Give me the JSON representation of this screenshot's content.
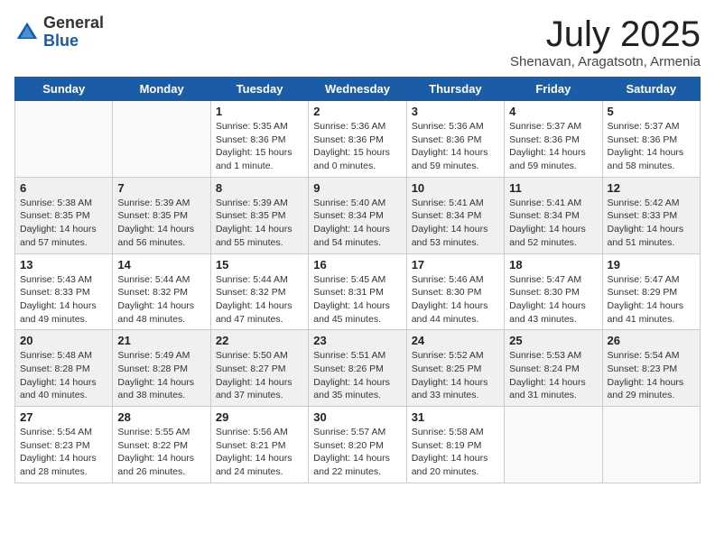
{
  "logo": {
    "general": "General",
    "blue": "Blue"
  },
  "title": "July 2025",
  "subtitle": "Shenavan, Aragatsotn, Armenia",
  "days_of_week": [
    "Sunday",
    "Monday",
    "Tuesday",
    "Wednesday",
    "Thursday",
    "Friday",
    "Saturday"
  ],
  "weeks": [
    [
      {
        "day": "",
        "sunrise": "",
        "sunset": "",
        "daylight": ""
      },
      {
        "day": "",
        "sunrise": "",
        "sunset": "",
        "daylight": ""
      },
      {
        "day": "1",
        "sunrise": "Sunrise: 5:35 AM",
        "sunset": "Sunset: 8:36 PM",
        "daylight": "Daylight: 15 hours and 1 minute."
      },
      {
        "day": "2",
        "sunrise": "Sunrise: 5:36 AM",
        "sunset": "Sunset: 8:36 PM",
        "daylight": "Daylight: 15 hours and 0 minutes."
      },
      {
        "day": "3",
        "sunrise": "Sunrise: 5:36 AM",
        "sunset": "Sunset: 8:36 PM",
        "daylight": "Daylight: 14 hours and 59 minutes."
      },
      {
        "day": "4",
        "sunrise": "Sunrise: 5:37 AM",
        "sunset": "Sunset: 8:36 PM",
        "daylight": "Daylight: 14 hours and 59 minutes."
      },
      {
        "day": "5",
        "sunrise": "Sunrise: 5:37 AM",
        "sunset": "Sunset: 8:36 PM",
        "daylight": "Daylight: 14 hours and 58 minutes."
      }
    ],
    [
      {
        "day": "6",
        "sunrise": "Sunrise: 5:38 AM",
        "sunset": "Sunset: 8:35 PM",
        "daylight": "Daylight: 14 hours and 57 minutes."
      },
      {
        "day": "7",
        "sunrise": "Sunrise: 5:39 AM",
        "sunset": "Sunset: 8:35 PM",
        "daylight": "Daylight: 14 hours and 56 minutes."
      },
      {
        "day": "8",
        "sunrise": "Sunrise: 5:39 AM",
        "sunset": "Sunset: 8:35 PM",
        "daylight": "Daylight: 14 hours and 55 minutes."
      },
      {
        "day": "9",
        "sunrise": "Sunrise: 5:40 AM",
        "sunset": "Sunset: 8:34 PM",
        "daylight": "Daylight: 14 hours and 54 minutes."
      },
      {
        "day": "10",
        "sunrise": "Sunrise: 5:41 AM",
        "sunset": "Sunset: 8:34 PM",
        "daylight": "Daylight: 14 hours and 53 minutes."
      },
      {
        "day": "11",
        "sunrise": "Sunrise: 5:41 AM",
        "sunset": "Sunset: 8:34 PM",
        "daylight": "Daylight: 14 hours and 52 minutes."
      },
      {
        "day": "12",
        "sunrise": "Sunrise: 5:42 AM",
        "sunset": "Sunset: 8:33 PM",
        "daylight": "Daylight: 14 hours and 51 minutes."
      }
    ],
    [
      {
        "day": "13",
        "sunrise": "Sunrise: 5:43 AM",
        "sunset": "Sunset: 8:33 PM",
        "daylight": "Daylight: 14 hours and 49 minutes."
      },
      {
        "day": "14",
        "sunrise": "Sunrise: 5:44 AM",
        "sunset": "Sunset: 8:32 PM",
        "daylight": "Daylight: 14 hours and 48 minutes."
      },
      {
        "day": "15",
        "sunrise": "Sunrise: 5:44 AM",
        "sunset": "Sunset: 8:32 PM",
        "daylight": "Daylight: 14 hours and 47 minutes."
      },
      {
        "day": "16",
        "sunrise": "Sunrise: 5:45 AM",
        "sunset": "Sunset: 8:31 PM",
        "daylight": "Daylight: 14 hours and 45 minutes."
      },
      {
        "day": "17",
        "sunrise": "Sunrise: 5:46 AM",
        "sunset": "Sunset: 8:30 PM",
        "daylight": "Daylight: 14 hours and 44 minutes."
      },
      {
        "day": "18",
        "sunrise": "Sunrise: 5:47 AM",
        "sunset": "Sunset: 8:30 PM",
        "daylight": "Daylight: 14 hours and 43 minutes."
      },
      {
        "day": "19",
        "sunrise": "Sunrise: 5:47 AM",
        "sunset": "Sunset: 8:29 PM",
        "daylight": "Daylight: 14 hours and 41 minutes."
      }
    ],
    [
      {
        "day": "20",
        "sunrise": "Sunrise: 5:48 AM",
        "sunset": "Sunset: 8:28 PM",
        "daylight": "Daylight: 14 hours and 40 minutes."
      },
      {
        "day": "21",
        "sunrise": "Sunrise: 5:49 AM",
        "sunset": "Sunset: 8:28 PM",
        "daylight": "Daylight: 14 hours and 38 minutes."
      },
      {
        "day": "22",
        "sunrise": "Sunrise: 5:50 AM",
        "sunset": "Sunset: 8:27 PM",
        "daylight": "Daylight: 14 hours and 37 minutes."
      },
      {
        "day": "23",
        "sunrise": "Sunrise: 5:51 AM",
        "sunset": "Sunset: 8:26 PM",
        "daylight": "Daylight: 14 hours and 35 minutes."
      },
      {
        "day": "24",
        "sunrise": "Sunrise: 5:52 AM",
        "sunset": "Sunset: 8:25 PM",
        "daylight": "Daylight: 14 hours and 33 minutes."
      },
      {
        "day": "25",
        "sunrise": "Sunrise: 5:53 AM",
        "sunset": "Sunset: 8:24 PM",
        "daylight": "Daylight: 14 hours and 31 minutes."
      },
      {
        "day": "26",
        "sunrise": "Sunrise: 5:54 AM",
        "sunset": "Sunset: 8:23 PM",
        "daylight": "Daylight: 14 hours and 29 minutes."
      }
    ],
    [
      {
        "day": "27",
        "sunrise": "Sunrise: 5:54 AM",
        "sunset": "Sunset: 8:23 PM",
        "daylight": "Daylight: 14 hours and 28 minutes."
      },
      {
        "day": "28",
        "sunrise": "Sunrise: 5:55 AM",
        "sunset": "Sunset: 8:22 PM",
        "daylight": "Daylight: 14 hours and 26 minutes."
      },
      {
        "day": "29",
        "sunrise": "Sunrise: 5:56 AM",
        "sunset": "Sunset: 8:21 PM",
        "daylight": "Daylight: 14 hours and 24 minutes."
      },
      {
        "day": "30",
        "sunrise": "Sunrise: 5:57 AM",
        "sunset": "Sunset: 8:20 PM",
        "daylight": "Daylight: 14 hours and 22 minutes."
      },
      {
        "day": "31",
        "sunrise": "Sunrise: 5:58 AM",
        "sunset": "Sunset: 8:19 PM",
        "daylight": "Daylight: 14 hours and 20 minutes."
      },
      {
        "day": "",
        "sunrise": "",
        "sunset": "",
        "daylight": ""
      },
      {
        "day": "",
        "sunrise": "",
        "sunset": "",
        "daylight": ""
      }
    ]
  ]
}
